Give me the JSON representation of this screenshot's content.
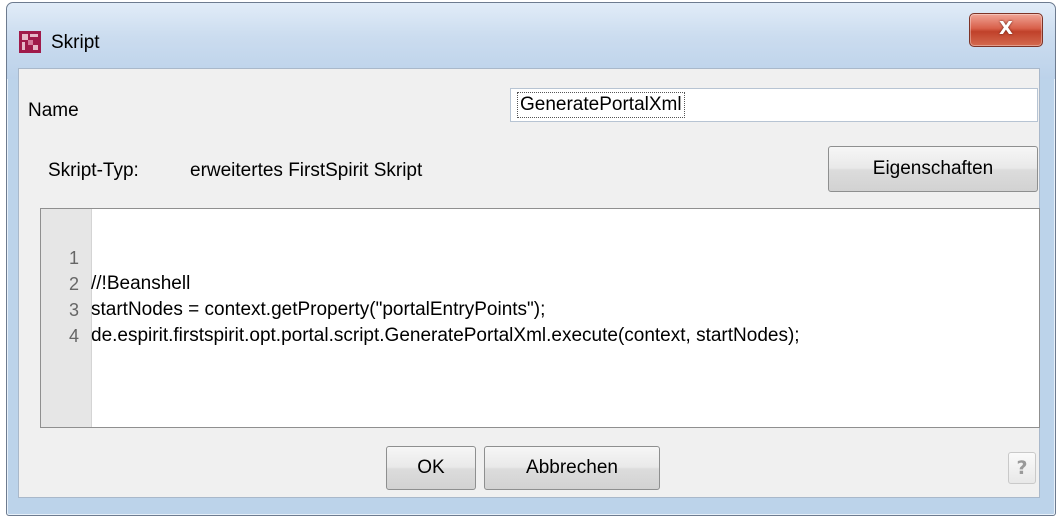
{
  "window": {
    "title": "Skript",
    "close_label": "X",
    "app_icon": "firstspirit-app-icon"
  },
  "form": {
    "name_label": "Name",
    "name_value": "GeneratePortalXml",
    "type_label": "Skript-Typ:",
    "type_value": "erweitertes FirstSpirit Skript",
    "properties_button": "Eigenschaften"
  },
  "editor": {
    "lines": [
      {
        "number": "1",
        "code": "//!Beanshell"
      },
      {
        "number": "2",
        "code": "startNodes = context.getProperty(\"portalEntryPoints\");"
      },
      {
        "number": "3",
        "code": "de.espirit.firstspirit.opt.portal.script.GeneratePortalXml.execute(context, startNodes);"
      },
      {
        "number": "4",
        "code": ""
      }
    ]
  },
  "buttons": {
    "ok": "OK",
    "cancel": "Abbrechen",
    "help": "?"
  },
  "colors": {
    "title_bar": "#bcd3ea",
    "close_button": "#c8452e",
    "app_icon": "#a01a4a",
    "dialog_background": "#f0f0f0"
  }
}
